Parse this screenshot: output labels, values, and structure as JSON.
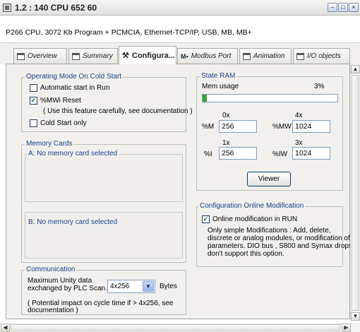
{
  "window": {
    "title": "1.2 : 140 CPU 652 60",
    "description": "P266 CPU, 3072 Kb Program + PCMCIA, Ethernet-TCP/IP, USB, MB, MB+"
  },
  "tabs": [
    {
      "label": "Overview",
      "icon": "document-icon",
      "active": false
    },
    {
      "label": "Summary",
      "icon": "document-icon",
      "active": false
    },
    {
      "label": "Configura...",
      "icon": "wrench-icon",
      "active": true
    },
    {
      "label": "Modbus Port",
      "icon": "modbus-icon",
      "active": false
    },
    {
      "label": "Animation",
      "icon": "document-icon",
      "active": false
    },
    {
      "label": "I/O objects",
      "icon": "document-icon",
      "active": false
    }
  ],
  "operating_mode": {
    "title": "Operating Mode On Cold Start",
    "auto_start_label": "Automatic start in Run",
    "auto_start_checked": false,
    "mwi_reset_label": "%MWi Reset",
    "mwi_reset_checked": true,
    "mwi_note": "( Use this feature carefully, see documentation )",
    "cold_start_label": "Cold Start only",
    "cold_start_checked": false
  },
  "memory_cards": {
    "title": "Memory Cards",
    "card_a": "A: No memory card selected",
    "card_b": "B: No memory card selected"
  },
  "communication": {
    "title": "Communication",
    "label_line1": "Maximum Unity data",
    "label_line2": "exchanged by PLC Scan.",
    "value": "4x256",
    "unit": "Bytes",
    "note_line1": "( Potential impact on cycle time if > 4x256, see",
    "note_line2": "documentation )"
  },
  "state_ram": {
    "title": "State RAM",
    "mem_usage_label": "Mem usage",
    "mem_usage_value": "3%",
    "mem_usage_fraction": 0.03,
    "rows": [
      {
        "left_header": "0x",
        "left_label": "%M",
        "left_value": "256",
        "right_header": "4x",
        "right_label": "%MW",
        "right_value": "1024"
      },
      {
        "left_header": "1x",
        "left_label": "%I",
        "left_value": "256",
        "right_header": "3x",
        "right_label": "%IW",
        "right_value": "1024"
      }
    ],
    "viewer_label": "Viewer"
  },
  "online_mod": {
    "title": "Configuration Online Modification",
    "checkbox_label": "Online modification in RUN",
    "checked": true,
    "note_lines": [
      "Only simple Modifications : Add, delete,",
      "discrete  or analog modules, or modification of",
      "parameters. DIO bus , S800 and Symax drops",
      "don't support this option."
    ]
  },
  "colors": {
    "group_title": "#1c3e8a",
    "checkmark": "#1a7a1a",
    "progress": "#3aa536"
  }
}
